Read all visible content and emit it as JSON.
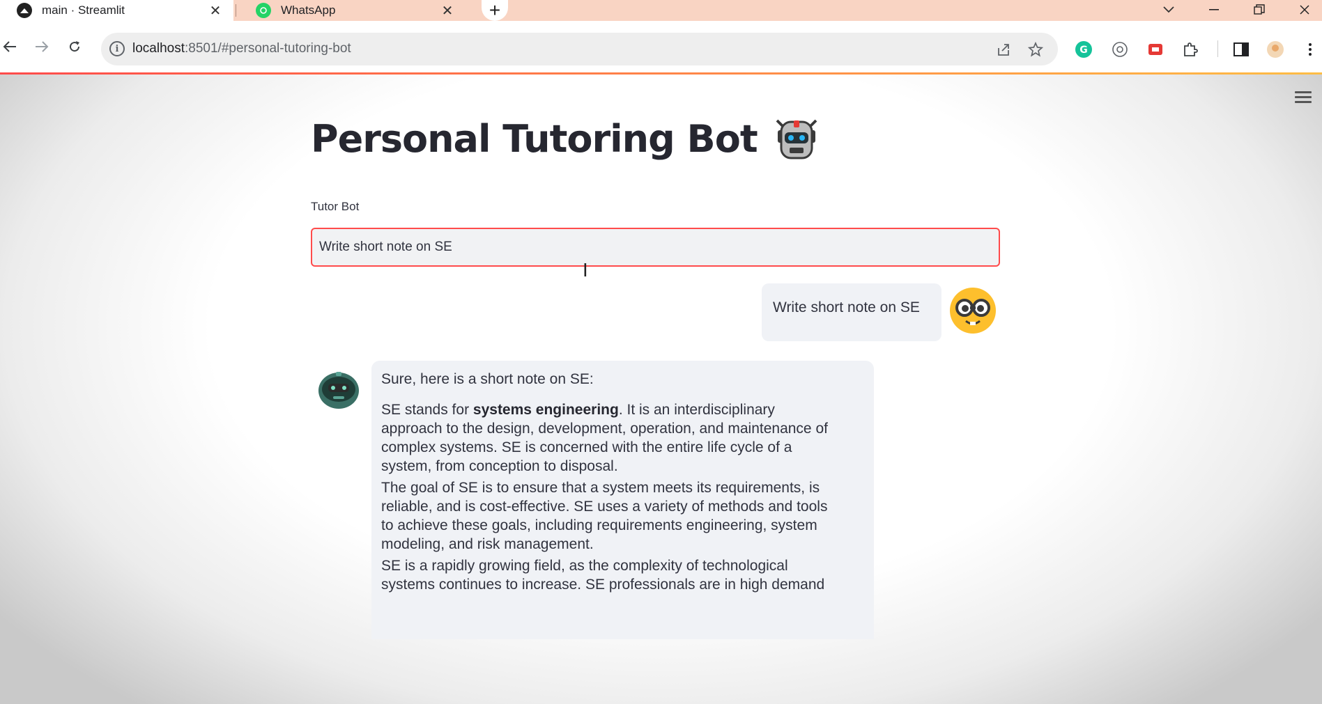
{
  "browser": {
    "tabs": [
      {
        "title": "main · Streamlit",
        "active": true
      },
      {
        "title": "WhatsApp",
        "active": false
      }
    ],
    "url_host": "localhost",
    "url_rest": ":8501/#personal-tutoring-bot"
  },
  "app": {
    "title": "Personal Tutoring Bot",
    "title_emoji": "robot-face-icon",
    "input_label": "Tutor Bot",
    "input_value": "Write short note on SE"
  },
  "chat": {
    "user_message": "Write short note on SE",
    "bot_intro": "Sure, here is a short note on SE:",
    "bot_p1_start": "SE stands for ",
    "bot_p1_bold": "systems engineering",
    "bot_p1_line1_rest": ". It is an interdisciplinary",
    "bot_p1_line2": "approach to the design, development, operation, and maintenance of",
    "bot_p1_line3": "complex systems. SE is concerned with the entire life cycle of a",
    "bot_p1_line4": "system, from conception to disposal.",
    "bot_p2_line1": "The goal of SE is to ensure that a system meets its requirements, is",
    "bot_p2_line2": "reliable, and is cost-effective. SE uses a variety of methods and tools",
    "bot_p2_line3": "to achieve these goals, including requirements engineering, system",
    "bot_p2_line4": "modeling, and risk management.",
    "bot_p3_line1": "SE is a rapidly growing field, as the complexity of technological",
    "bot_p3_line2": "systems continues to increase. SE professionals are in high demand"
  },
  "colors": {
    "accent": "#ff4b4b",
    "tabstrip": "#f9d4c3",
    "bubble": "#f0f2f6"
  }
}
